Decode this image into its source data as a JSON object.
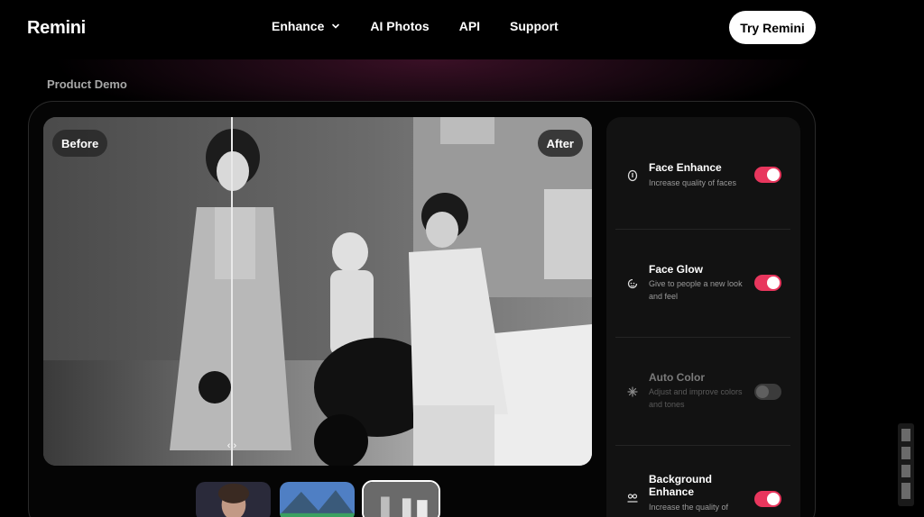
{
  "nav": {
    "logo": "Remini",
    "links": [
      {
        "label": "Enhance",
        "dropdown": true
      },
      {
        "label": "AI Photos"
      },
      {
        "label": "API"
      },
      {
        "label": "Support"
      }
    ],
    "cta": "Try Remini"
  },
  "demo": {
    "section_label": "Product Demo",
    "before_label": "Before",
    "after_label": "After",
    "handle": "‹ ›",
    "thumbnails": [
      {
        "name": "portrait",
        "active": false
      },
      {
        "name": "landscape",
        "active": false
      },
      {
        "name": "vintage-family",
        "active": true
      }
    ]
  },
  "options": [
    {
      "title": "Face Enhance",
      "desc": "Increase quality of faces",
      "icon": "face-enhance-icon",
      "enabled": true
    },
    {
      "title": "Face Glow",
      "desc": "Give to people a new look and feel",
      "icon": "face-glow-icon",
      "enabled": true
    },
    {
      "title": "Auto Color",
      "desc": "Adjust and improve colors and tones",
      "icon": "sparkle-icon",
      "enabled": false
    },
    {
      "title": "Background Enhance",
      "desc": "Increase the quality of",
      "icon": "background-icon",
      "enabled": true
    }
  ],
  "colors": {
    "toggle_on": "#e8365d",
    "toggle_off": "#3b3b3b",
    "panel": "#121212"
  }
}
